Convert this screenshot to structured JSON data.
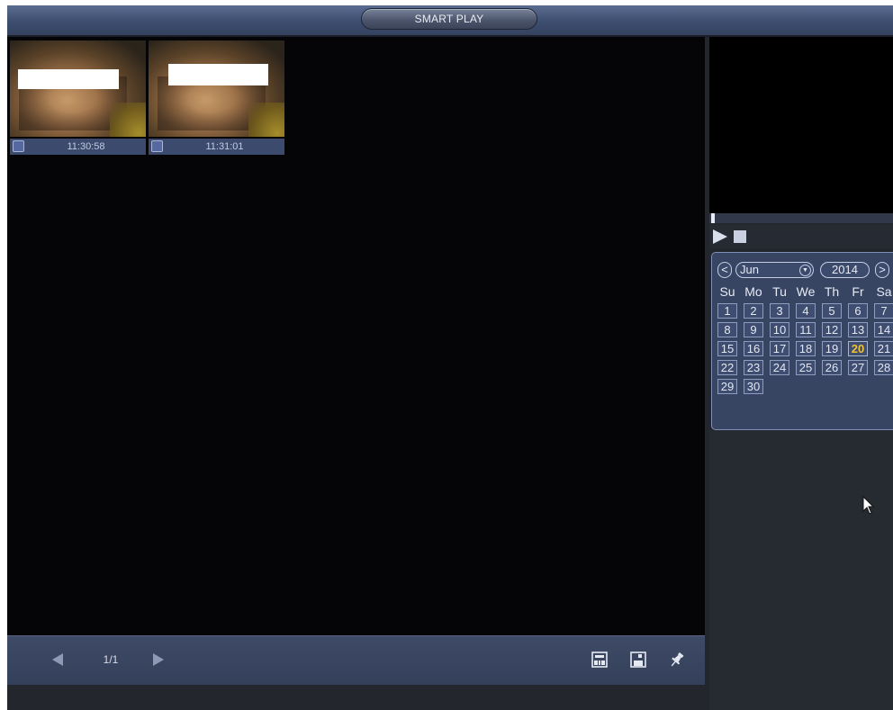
{
  "window": {
    "title": "SMART PLAY"
  },
  "thumbnails": [
    {
      "time": "11:30:58",
      "checked": false
    },
    {
      "time": "11:31:01",
      "checked": false
    }
  ],
  "toolbar": {
    "page_indicator": "1/1",
    "prev_icon": "triangle-left-icon",
    "next_icon": "triangle-right-icon",
    "right_icons": [
      "backup-icon",
      "save-icon",
      "pin-icon"
    ]
  },
  "player": {
    "play_icon": "play-icon",
    "stop_icon": "stop-icon"
  },
  "calendar": {
    "prev": "<",
    "next": ">",
    "month": "Jun",
    "year": "2014",
    "weekdays": [
      "Su",
      "Mo",
      "Tu",
      "We",
      "Th",
      "Fr",
      "Sa"
    ],
    "days": [
      "1",
      "2",
      "3",
      "4",
      "5",
      "6",
      "7",
      "8",
      "9",
      "10",
      "11",
      "12",
      "13",
      "14",
      "15",
      "16",
      "17",
      "18",
      "19",
      "20",
      "21",
      "22",
      "23",
      "24",
      "25",
      "26",
      "27",
      "28",
      "29",
      "30"
    ],
    "first_weekday_index": 0,
    "selected_day": "20"
  },
  "colors": {
    "accent_today": "#f2c230",
    "titlebar": "#3e4e70",
    "panel": "#374563"
  }
}
